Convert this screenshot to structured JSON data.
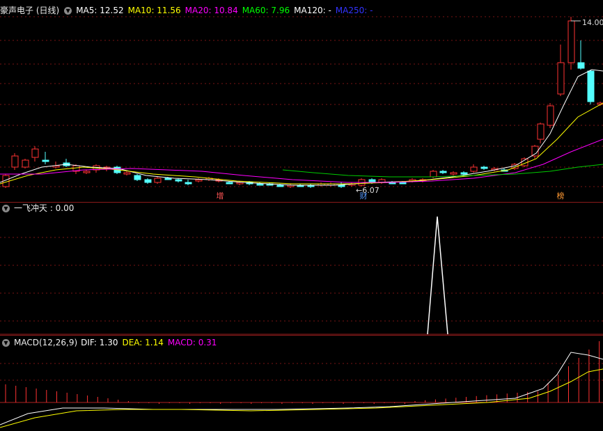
{
  "main": {
    "title": "豪声电子 (日线)",
    "ma": [
      {
        "label": "MA5: 12.52",
        "color": "#ffffff"
      },
      {
        "label": "MA10: 11.56",
        "color": "#ffff00"
      },
      {
        "label": "MA20: 10.84",
        "color": "#ff00ff"
      },
      {
        "label": "MA60: 7.96",
        "color": "#00ff00"
      },
      {
        "label": "MA120: -",
        "color": "#ffffff"
      },
      {
        "label": "MA250: -",
        "color": "#0000ff"
      }
    ],
    "high_label": "14.00",
    "low_label": "6.07",
    "events": [
      {
        "label": "增",
        "color": "#ff5555"
      },
      {
        "label": "财",
        "color": "#5599ff"
      },
      {
        "label": "榜",
        "color": "#ff9933"
      }
    ]
  },
  "indicator": {
    "label": "一飞冲天 : 0.00"
  },
  "macd": {
    "name": "MACD(12,26,9)",
    "dif": "DIF: 1.30",
    "dea": "DEA: 1.14",
    "macd": "MACD: 0.31"
  },
  "colors": {
    "up": "#ff3232",
    "down": "#54ffff",
    "grid": "#8b1a1a"
  }
}
